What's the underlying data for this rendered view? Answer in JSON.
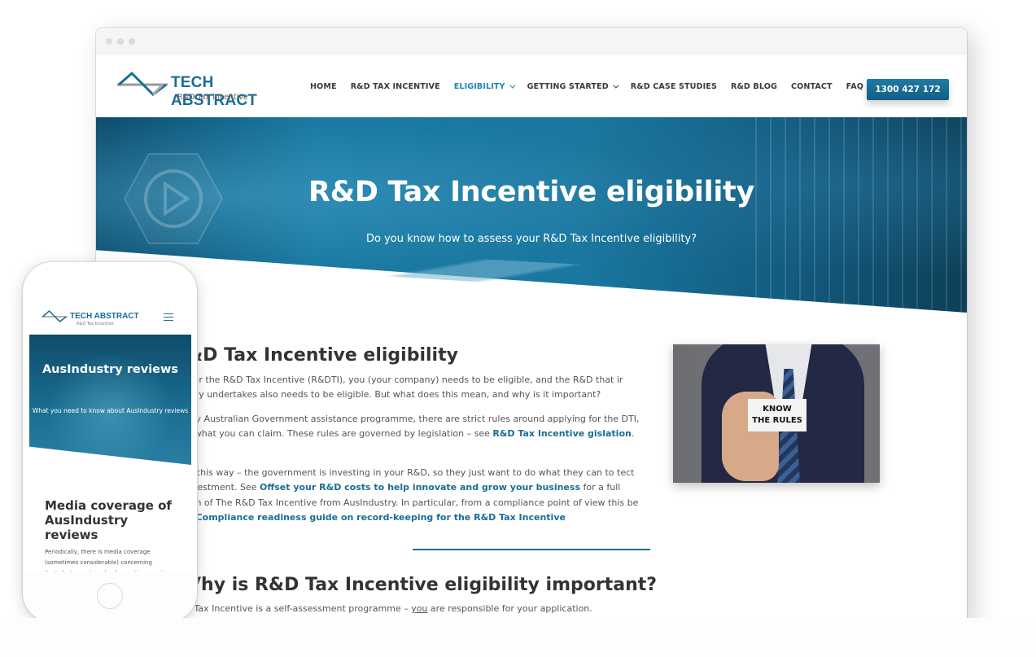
{
  "browser": {
    "window_dots": [
      "close",
      "minimize",
      "maximize"
    ]
  },
  "header": {
    "logo": {
      "title": "TECH ABSTRACT",
      "subtitle": "R&D Tax Incentive",
      "icon": "logo-wave-icon"
    },
    "nav": [
      {
        "label": "HOME",
        "active": false,
        "dropdown": false
      },
      {
        "label": "R&D TAX INCENTIVE",
        "active": false,
        "dropdown": false
      },
      {
        "label": "ELIGIBILITY",
        "active": true,
        "dropdown": true
      },
      {
        "label": "GETTING STARTED",
        "active": false,
        "dropdown": true
      },
      {
        "label": "R&D CASE STUDIES",
        "active": false,
        "dropdown": false
      },
      {
        "label": "R&D BLOG",
        "active": false,
        "dropdown": false
      },
      {
        "label": "CONTACT",
        "active": false,
        "dropdown": false
      },
      {
        "label": "FAQ",
        "active": false,
        "dropdown": false
      }
    ],
    "phone_button": "1300 427 172"
  },
  "hero": {
    "title": "R&D Tax Incentive eligibility",
    "subtitle": "Do you know how to assess your R&D Tax Incentive eligibility?"
  },
  "main": {
    "section1": {
      "heading": "&D Tax Incentive eligibility",
      "p1": "apply for the R&D Tax Incentive (R&DTI), you (your company) needs to be eligible, and the R&D that ir company undertakes also needs to be eligible. But what does this mean, and why is it important?",
      "p2_before": "with any Australian Government assistance programme, there are strict rules around applying for the DTI, and to what you can claim. These rules are governed by legislation – see ",
      "p2_link": "R&D Tax Incentive gislation",
      "p2_after": ".",
      "p3_before": "nk of it this way – the government is investing in your R&D, so they just want to do what they can to tect that investment. See ",
      "p3_link1": "Offset your R&D costs to help innovate and grow your business",
      "p3_mid": " for a full scription of The R&D Tax Incentive from AusIndustry. In particular, from a compliance point of view this be useful: ",
      "p3_link2": "Compliance readiness guide on record-keeping for the R&D Tax Incentive"
    },
    "section2": {
      "heading": "Vhy is R&D Tax Incentive eligibility important?",
      "p1_before": "e R&D Tax Incentive is a self-assessment programme – ",
      "p1_underline": "you",
      "p1_after": " are responsible for your application."
    },
    "photo": {
      "card_line1": "KNOW",
      "card_line2": "THE RULES"
    }
  },
  "mobile": {
    "logo": {
      "title": "TECH ABSTRACT",
      "subtitle": "R&D Tax Incentive"
    },
    "hero_title": "AusIndustry reviews",
    "hero_subtitle": "What you need to know about AusIndustry reviews",
    "heading": "Media coverage of AusIndustry reviews",
    "paragraph": "Periodically, there is media coverage (sometimes considerable) concerning AusIndustry reviews (and sometimes reviews by the Australian Tax Office) of"
  },
  "colors": {
    "brand": "#1b6d93",
    "nav_active": "#1e85b3",
    "text": "#333333"
  }
}
